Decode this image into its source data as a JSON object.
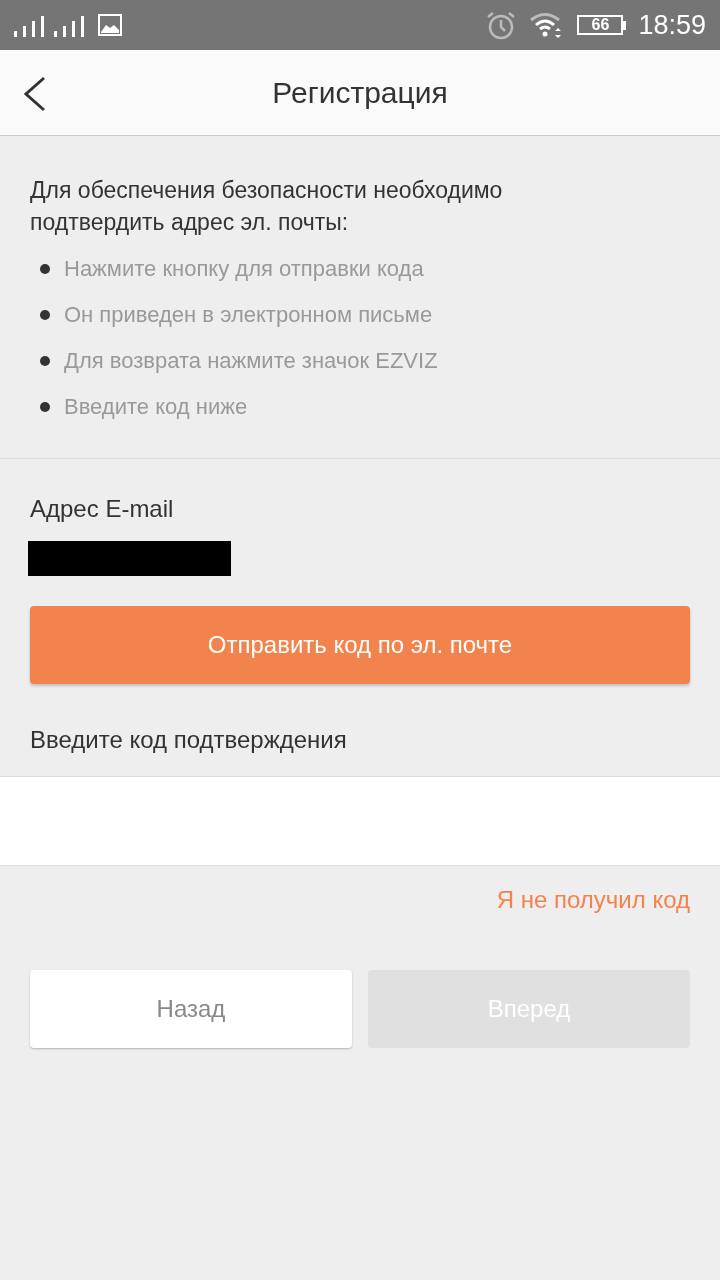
{
  "status_bar": {
    "battery": "66",
    "time": "18:59"
  },
  "header": {
    "title": "Регистрация"
  },
  "intro": {
    "text": "Для обеспечения безопасности необходимо подтвердить адрес эл. почты:",
    "steps": [
      "Нажмите кнопку для отправки кода",
      "Он приведен в электронном письме",
      "Для возврата нажмите значок EZVIZ",
      "Введите код ниже"
    ]
  },
  "email": {
    "label": "Адрес E-mail",
    "redacted": true
  },
  "send_button": "Отправить код по эл. почте",
  "code": {
    "label": "Введите код подтверждения"
  },
  "no_code_link": "Я не получил код",
  "buttons": [
    {
      "label": "Назад",
      "disabled": false
    },
    {
      "label": "Вперед",
      "disabled": true
    }
  ]
}
